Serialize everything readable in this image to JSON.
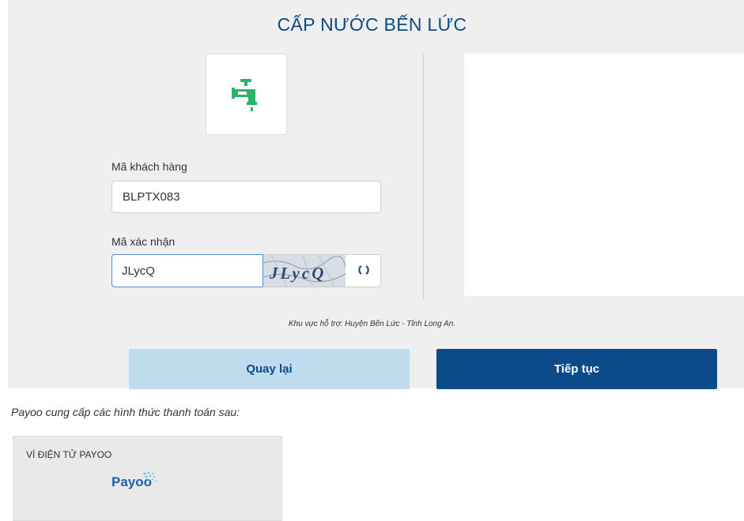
{
  "page": {
    "title": "CẤP NƯỚC BẾN LỨC"
  },
  "form": {
    "customer_code_label": "Mã khách hàng",
    "customer_code_value": "BLPTX083",
    "captcha_label": "Mã xác nhận",
    "captcha_value": "JLycQ",
    "captcha_text": "JLycQ"
  },
  "support_text": "Khu vực hỗ trợ: Huyện Bến Lức - Tỉnh Long An.",
  "buttons": {
    "back": "Quay lại",
    "next": "Tiếp tục"
  },
  "payment": {
    "intro": "Payoo cung cấp các hình thức thanh toán sau:",
    "wallet_title": "VÍ ĐIỆN TỬ PAYOO",
    "brand": "Payoo"
  },
  "colors": {
    "brand_blue": "#0d4a8a",
    "back_button": "#bfdcef",
    "icon_green": "#2bb36a",
    "background": "#efefef"
  },
  "icons": {
    "logo": "water-tap-icon",
    "refresh": "refresh-icon"
  }
}
